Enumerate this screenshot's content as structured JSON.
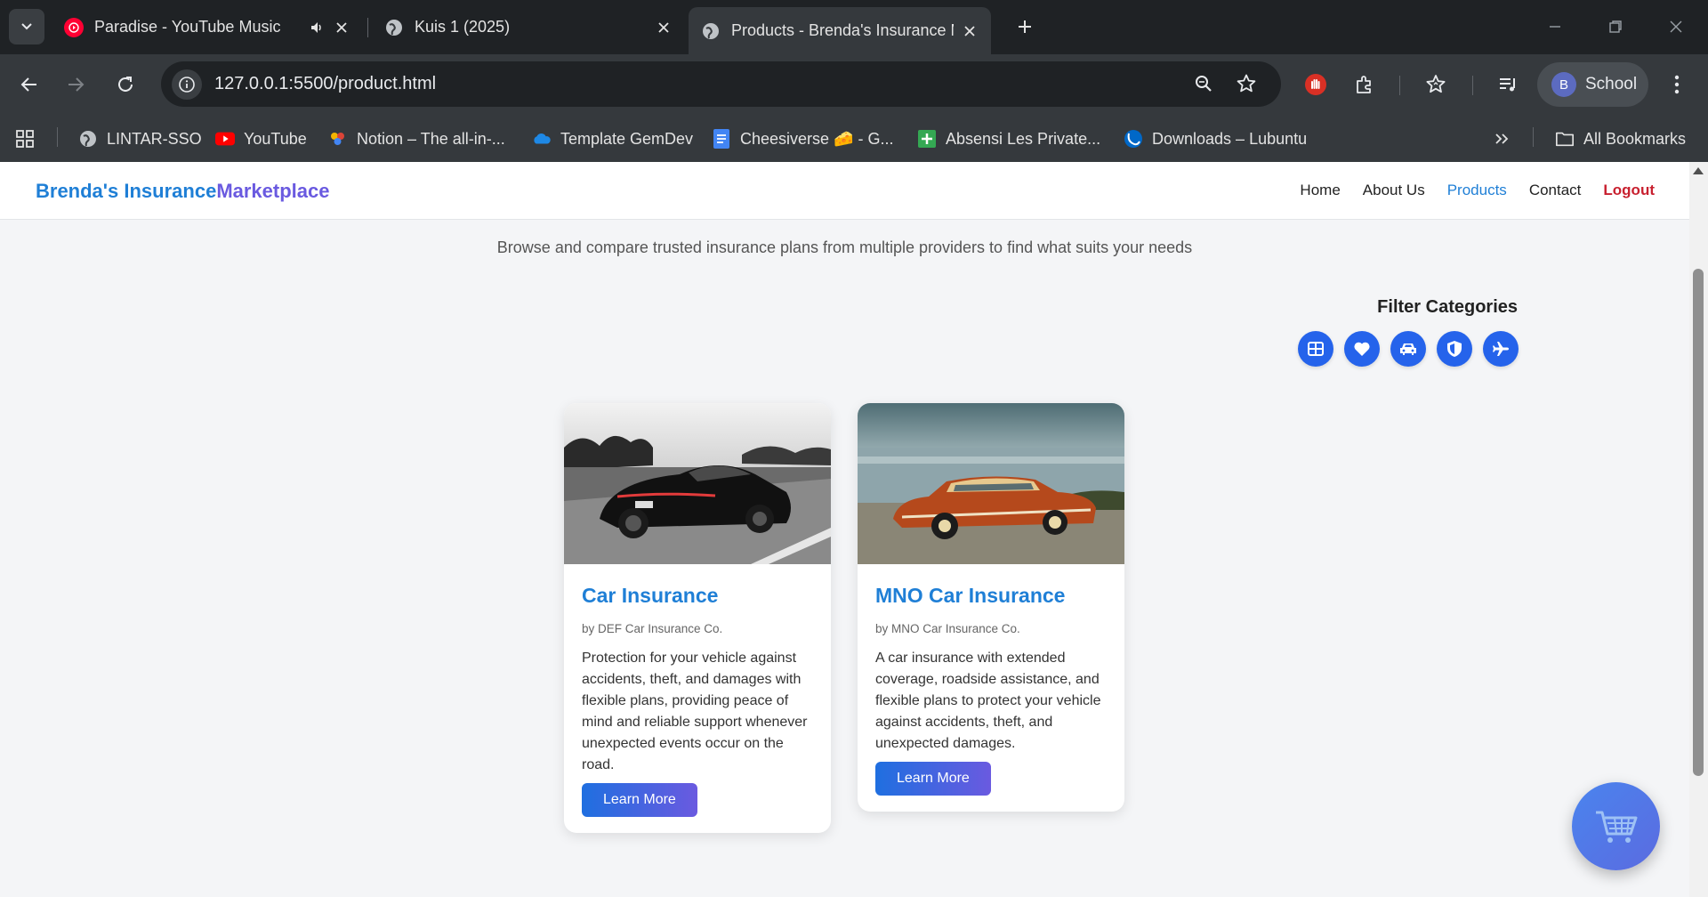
{
  "browser": {
    "tabs": [
      {
        "title": "Paradise - YouTube Music",
        "favicon": "youtube-music-icon",
        "audio": true
      },
      {
        "title": "Kuis 1 (2025)",
        "favicon": "globe-icon"
      },
      {
        "title": "Products - Brenda's Insurance M",
        "favicon": "globe-icon",
        "active": true
      }
    ],
    "url": "127.0.0.1:5500/product.html",
    "profile": {
      "initial": "B",
      "name": "School"
    },
    "bookmarks": [
      {
        "label": "LINTAR-SSO",
        "icon": "globe-icon"
      },
      {
        "label": "YouTube",
        "icon": "youtube-icon"
      },
      {
        "label": "Notion – The all-in-...",
        "icon": "notion-icon"
      },
      {
        "label": "Template GemDev",
        "icon": "onedrive-icon"
      },
      {
        "label": "Cheesiverse 🧀 - G...",
        "icon": "docs-icon"
      },
      {
        "label": "Absensi Les Private...",
        "icon": "sheets-icon"
      },
      {
        "label": "Downloads – Lubuntu",
        "icon": "lubuntu-icon"
      }
    ],
    "all_bookmarks": "All Bookmarks"
  },
  "site": {
    "brand_part1": "Brenda's Insurance",
    "brand_part2": "Marketplace",
    "nav": [
      "Home",
      "About Us",
      "Products",
      "Contact",
      "Logout"
    ],
    "active_nav": "Products",
    "subtitle": "Browse and compare trusted insurance plans from multiple providers to find what suits your needs",
    "filter_title": "Filter Categories",
    "filters": [
      "grid-icon",
      "heart-icon",
      "car-icon",
      "shield-icon",
      "plane-icon"
    ],
    "products": [
      {
        "title": "Car Insurance",
        "provider": "by DEF Car Insurance Co.",
        "description": "Protection for your vehicle against accidents, theft, and damages with flexible plans, providing peace of mind and reliable support whenever unexpected events occur on the road.",
        "button": "Learn More"
      },
      {
        "title": "MNO Car Insurance",
        "provider": "by MNO Car Insurance Co.",
        "description": "A car insurance with extended coverage, roadside assistance, and flexible plans to protect your vehicle against accidents, theft, and unexpected damages.",
        "button": "Learn More"
      }
    ],
    "fab_icon": "cart-icon"
  },
  "colors": {
    "brand_blue": "#1f7fd6",
    "brand_purple": "#6a5ae0",
    "logout_red": "#c8202f",
    "filter_blue": "#2563eb"
  }
}
